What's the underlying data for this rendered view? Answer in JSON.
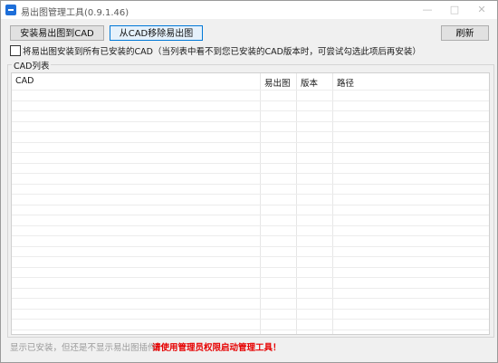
{
  "window": {
    "title": "易出图管理工具(0.9.1.46)"
  },
  "toolbar": {
    "install_label": "安装易出图到CAD",
    "remove_label": "从CAD移除易出图",
    "refresh_label": "刷新"
  },
  "option": {
    "install_all_label": "将易出图安装到所有已安装的CAD（当列表中看不到您已安装的CAD版本时，可尝试勾选此项后再安装）",
    "checked": false
  },
  "group": {
    "title": "CAD列表"
  },
  "table": {
    "columns": [
      "CAD",
      "易出图",
      "版本",
      "路径"
    ],
    "rows": []
  },
  "status": {
    "hint": "显示已安装，但还是不显示易出图插件？",
    "warning": "请使用管理员权限启动管理工具！"
  },
  "colors": {
    "accent": "#0078d7",
    "warning": "#e60000",
    "app_icon": "#1e6fd9"
  },
  "icons": {
    "app": "app-icon",
    "minimize": "minimize-icon",
    "maximize": "maximize-icon",
    "close": "close-icon"
  }
}
